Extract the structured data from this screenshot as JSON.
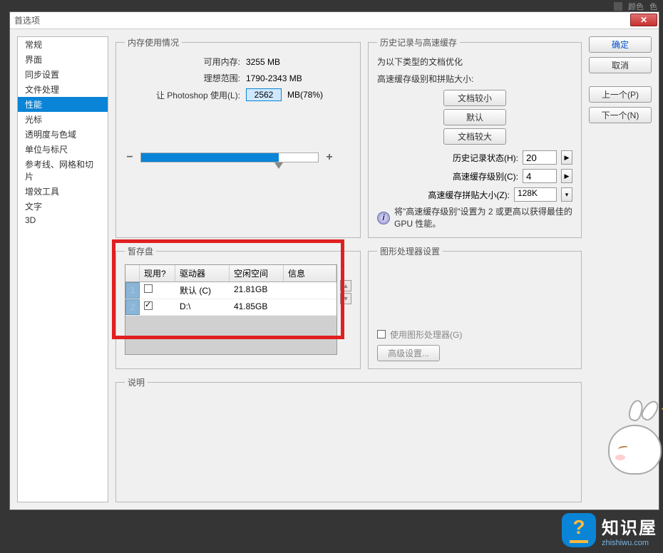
{
  "topbar": {
    "color_label": "颜色",
    "swatch_label": "色"
  },
  "dialog": {
    "title": "首选项"
  },
  "sidebar": {
    "items": [
      {
        "label": "常规"
      },
      {
        "label": "界面"
      },
      {
        "label": "同步设置"
      },
      {
        "label": "文件处理"
      },
      {
        "label": "性能"
      },
      {
        "label": "光标"
      },
      {
        "label": "透明度与色域"
      },
      {
        "label": "单位与标尺"
      },
      {
        "label": "参考线、网格和切片"
      },
      {
        "label": "增效工具"
      },
      {
        "label": "文字"
      },
      {
        "label": "3D"
      }
    ],
    "selected_index": 4
  },
  "buttons": {
    "ok": "确定",
    "cancel": "取消",
    "prev": "上一个(P)",
    "next": "下一个(N)"
  },
  "memory": {
    "legend": "内存使用情况",
    "available_label": "可用内存:",
    "available_value": "3255 MB",
    "ideal_label": "理想范围:",
    "ideal_value": "1790-2343 MB",
    "let_label": "让 Photoshop 使用(L):",
    "let_value": "2562",
    "let_suffix": "MB(78%)"
  },
  "history": {
    "legend": "历史记录与高速缓存",
    "intro1": "为以下类型的文档优化",
    "intro2": "高速缓存级别和拼贴大小:",
    "btn_small": "文档较小",
    "btn_default": "默认",
    "btn_large": "文档较大",
    "states_label": "历史记录状态(H):",
    "states_value": "20",
    "cache_label": "高速缓存级别(C):",
    "cache_value": "4",
    "tile_label": "高速缓存拼贴大小(Z):",
    "tile_value": "128K",
    "note": "将\"高速缓存级别\"设置为 2 或更高以获得最佳的 GPU 性能。"
  },
  "scratch": {
    "legend": "暂存盘",
    "headers": {
      "active": "现用?",
      "drive": "驱动器",
      "free": "空闲空间",
      "info": "信息"
    },
    "rows": [
      {
        "n": "1",
        "active": false,
        "drive": "默认 (C)",
        "free": "21.81GB",
        "info": ""
      },
      {
        "n": "2",
        "active": true,
        "drive": "D:\\",
        "free": "41.85GB",
        "info": ""
      }
    ]
  },
  "gpu": {
    "legend": "图形处理器设置",
    "use_label": "使用图形处理器(G)",
    "advanced": "高级设置..."
  },
  "desc": {
    "legend": "说明"
  },
  "logo": {
    "cn": "知识屋",
    "en": "zhishiwu.com"
  }
}
